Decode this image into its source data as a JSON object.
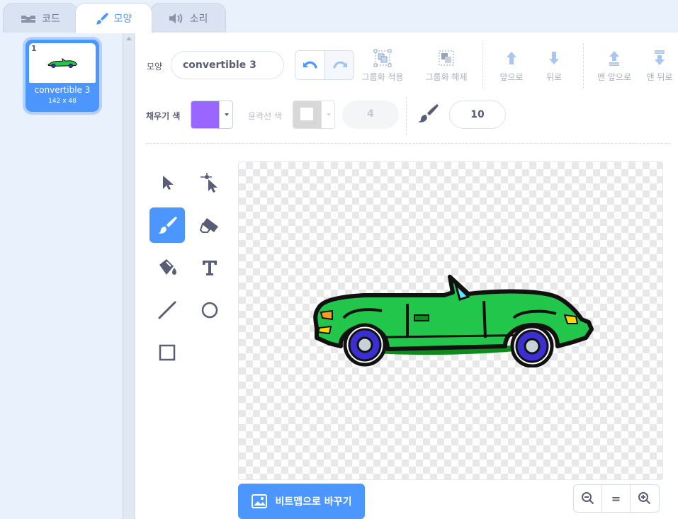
{
  "tabs": [
    {
      "label": "코드",
      "icon": "code-icon"
    },
    {
      "label": "모양",
      "icon": "brush-icon",
      "active": true
    },
    {
      "label": "소리",
      "icon": "speaker-icon"
    }
  ],
  "costumes": [
    {
      "number": "1",
      "name": "convertible 3",
      "size": "142 x 48",
      "selected": true
    }
  ],
  "toolbar": {
    "costume_label": "모양",
    "costume_name": "convertible 3",
    "group_label": "그룹화 적용",
    "ungroup_label": "그룹화 해제",
    "forward_label": "앞으로",
    "backward_label": "뒤로",
    "front_label": "맨 앞으로",
    "back_label": "맨 뒤로"
  },
  "style_row": {
    "fill_label": "채우기 색",
    "fill_color": "#9966ff",
    "outline_label": "윤곽선 색",
    "outline_width": "4",
    "brush_size": "10"
  },
  "tools": [
    {
      "name": "select",
      "icon": "arrow-select-icon"
    },
    {
      "name": "reshape",
      "icon": "reshape-icon"
    },
    {
      "name": "brush",
      "icon": "brush-icon",
      "active": true
    },
    {
      "name": "eraser",
      "icon": "eraser-icon"
    },
    {
      "name": "fill",
      "icon": "paint-bucket-icon"
    },
    {
      "name": "text",
      "icon": "text-icon"
    },
    {
      "name": "line",
      "icon": "line-icon"
    },
    {
      "name": "circle",
      "icon": "circle-icon"
    },
    {
      "name": "rectangle",
      "icon": "rectangle-icon"
    }
  ],
  "bitmap_button": "비트맵으로 바꾸기",
  "zoom": {
    "zoom_out": "zoom-out-icon",
    "reset": "=",
    "zoom_in": "zoom-in-icon"
  },
  "colors": {
    "accent": "#4c97ff",
    "car_body": "#22c64a",
    "car_outline": "#1a1a1a",
    "wheel": "#3b2fcf"
  }
}
